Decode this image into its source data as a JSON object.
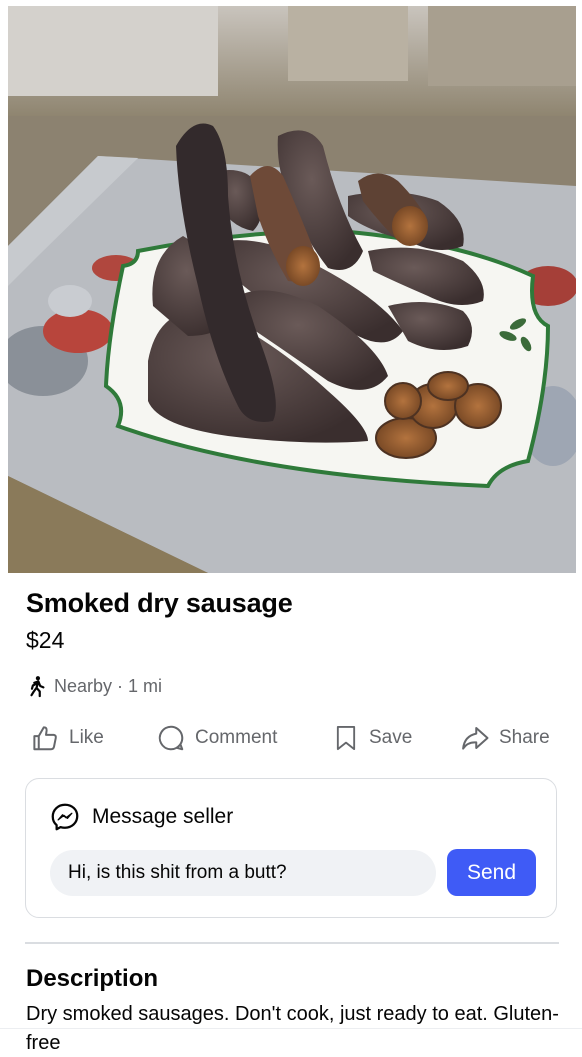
{
  "listing": {
    "title": "Smoked dry sausage",
    "price": "$24",
    "location": "Nearby · 1 mi",
    "location_icon": "walking-person-icon",
    "photo_alt": "Smoked dry sausage"
  },
  "actions": {
    "like_label": "Like",
    "comment_label": "Comment",
    "save_label": "Save",
    "share_label": "Share"
  },
  "message": {
    "heading": "Message seller",
    "input_value": "Hi, is this shit from a butt?",
    "send_label": "Send",
    "icon": "messenger-icon"
  },
  "description": {
    "heading": "Description",
    "text": "Dry smoked sausages. Don't cook, just ready to eat. Gluten-free"
  },
  "colors": {
    "accent": "#3f5bf6",
    "secondary_text": "#65676b",
    "input_bg": "#f0f2f5",
    "border": "#dadde1"
  }
}
